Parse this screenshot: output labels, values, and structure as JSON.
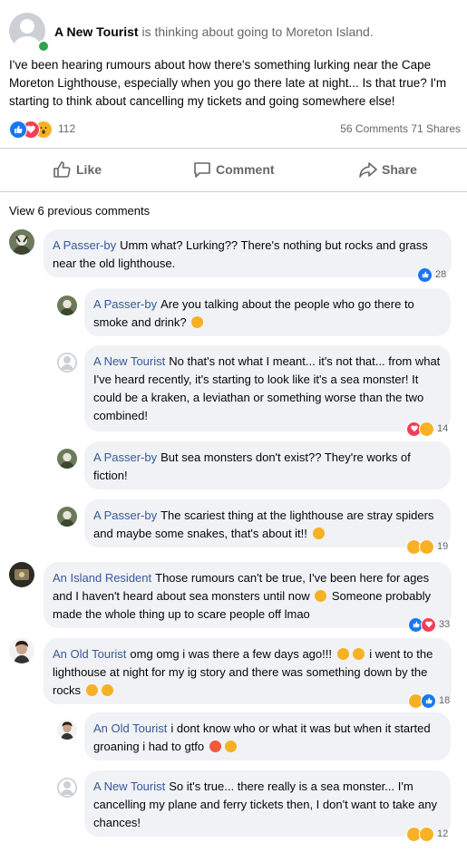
{
  "post": {
    "author": "A New Tourist",
    "activity": "is thinking about going to Moreton Island.",
    "body": "I've been hearing rumours about how there's something lurking near the Cape Moreton Lighthouse, especially when you go there late at night... Is that true? I'm starting to think about cancelling my tickets and going somewhere else!",
    "reaction_count": "112",
    "reactions": [
      "like",
      "love",
      "wow"
    ],
    "comments_count": "56 Comments",
    "shares_count": "71 Shares"
  },
  "actions": {
    "like": "Like",
    "comment": "Comment",
    "share": "Share"
  },
  "view_previous": "View 6 previous comments",
  "comments": [
    {
      "author": "A Passer-by",
      "text": "Umm what? Lurking?? There's nothing but rocks and grass near the old lighthouse.",
      "reactions": [
        "like"
      ],
      "count": "28"
    },
    {
      "author": "A Passer-by",
      "text": "Are you talking about the people who go there to smoke and drink?",
      "emoji": "😳",
      "reactions": [],
      "count": ""
    },
    {
      "author": "A New Tourist",
      "text": "No that's not what I meant... it's not that... from what I've heard recently, it's starting to look like it's a sea monster! It could be a kraken, a leviathan or something worse than the two combined!",
      "reactions": [
        "love",
        "haha"
      ],
      "count": "14"
    },
    {
      "author": "A Passer-by",
      "text": "But sea monsters don't exist?? They're works of fiction!",
      "reactions": [],
      "count": ""
    },
    {
      "author": "A Passer-by",
      "text": "The scariest thing at the lighthouse are stray spiders and maybe some snakes, that's about it!!",
      "emoji": "🙃",
      "reactions": [
        "haha",
        "sad"
      ],
      "count": "19"
    },
    {
      "author": "An Island Resident",
      "text_a": "Those rumours can't be true, I've been here for ages and I haven't heard about sea monsters until now",
      "emoji": "🤔",
      "text_b": "Someone probably made the whole thing up to scare people off lmao",
      "reactions": [
        "like",
        "love"
      ],
      "count": "33"
    },
    {
      "author": "An Old Tourist",
      "text_a": "omg omg i was there a few days ago!!!",
      "emoji_a": "😳",
      "emoji_b": "😮",
      "text_b": "i went to the lighthouse at night for my ig story and there was something down by the rocks",
      "emoji_c": "😱",
      "emoji_d": "🙀",
      "reactions": [
        "wow",
        "like"
      ],
      "count": "18"
    },
    {
      "author": "An Old Tourist",
      "text": "i dont know who or what it was but when it started groaning i had to gtfo",
      "emoji_a": "😭",
      "emoji_b": "😤",
      "reactions": [],
      "count": ""
    },
    {
      "author": "A New Tourist",
      "text": "So it's true... there really is a sea monster... I'm cancelling my plane and ferry tickets then, I don't want to take any chances!",
      "reactions": [
        "wow",
        "sad"
      ],
      "count": "12"
    }
  ],
  "colors": {
    "link": "#385898",
    "like": "#1877f2",
    "love": "#f33e58",
    "yellow": "#f7b125",
    "bubble": "#f0f2f5",
    "online": "#31a24c"
  }
}
